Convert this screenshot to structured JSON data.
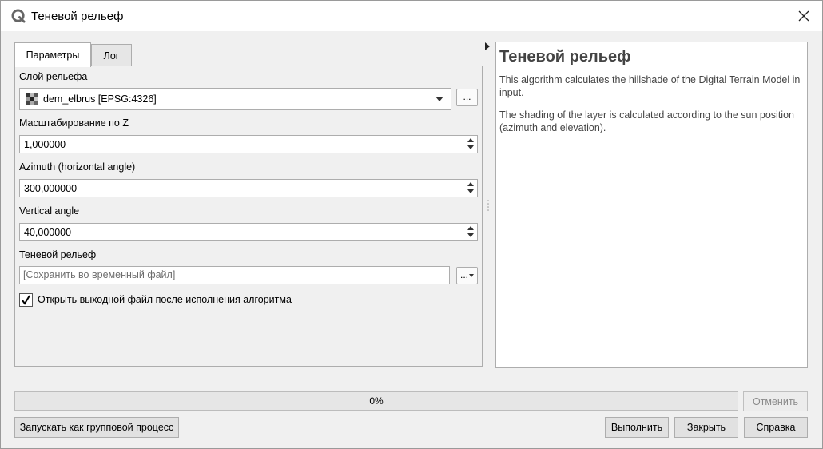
{
  "window": {
    "title": "Теневой рельеф"
  },
  "tabs": [
    {
      "label": "Параметры",
      "active": true
    },
    {
      "label": "Лог",
      "active": false
    }
  ],
  "params": {
    "dem_layer": {
      "label": "Слой рельефа",
      "value": "dem_elbrus [EPSG:4326]",
      "browse_label": "..."
    },
    "z_factor": {
      "label": "Масштабирование по Z",
      "value": "1,000000"
    },
    "azimuth": {
      "label": "Azimuth (horizontal angle)",
      "value": "300,000000"
    },
    "vertical_angle": {
      "label": "Vertical angle",
      "value": "40,000000"
    },
    "output": {
      "label": "Теневой рельеф",
      "placeholder": "[Сохранить во временный файл]",
      "browse_label": "..."
    },
    "open_output": {
      "label": "Открыть выходной файл после исполнения алгоритма",
      "checked": true
    }
  },
  "help": {
    "title": "Теневой рельеф",
    "paragraphs": [
      "This algorithm calculates the hillshade of the Digital Terrain Model in input.",
      "The shading of the layer is calculated according to the sun position (azimuth and elevation)."
    ]
  },
  "progress": {
    "value": 0,
    "text": "0%"
  },
  "buttons": {
    "cancel": "Отменить",
    "batch": "Запускать как групповой процесс",
    "run": "Выполнить",
    "close": "Закрыть",
    "help": "Справка"
  },
  "icons": {
    "app": "qgis-logo-icon",
    "close": "close-icon",
    "layer": "raster-layer-icon",
    "dropdown": "chevron-down-icon",
    "collapse": "chevron-right-icon",
    "check": "checkmark-icon"
  }
}
